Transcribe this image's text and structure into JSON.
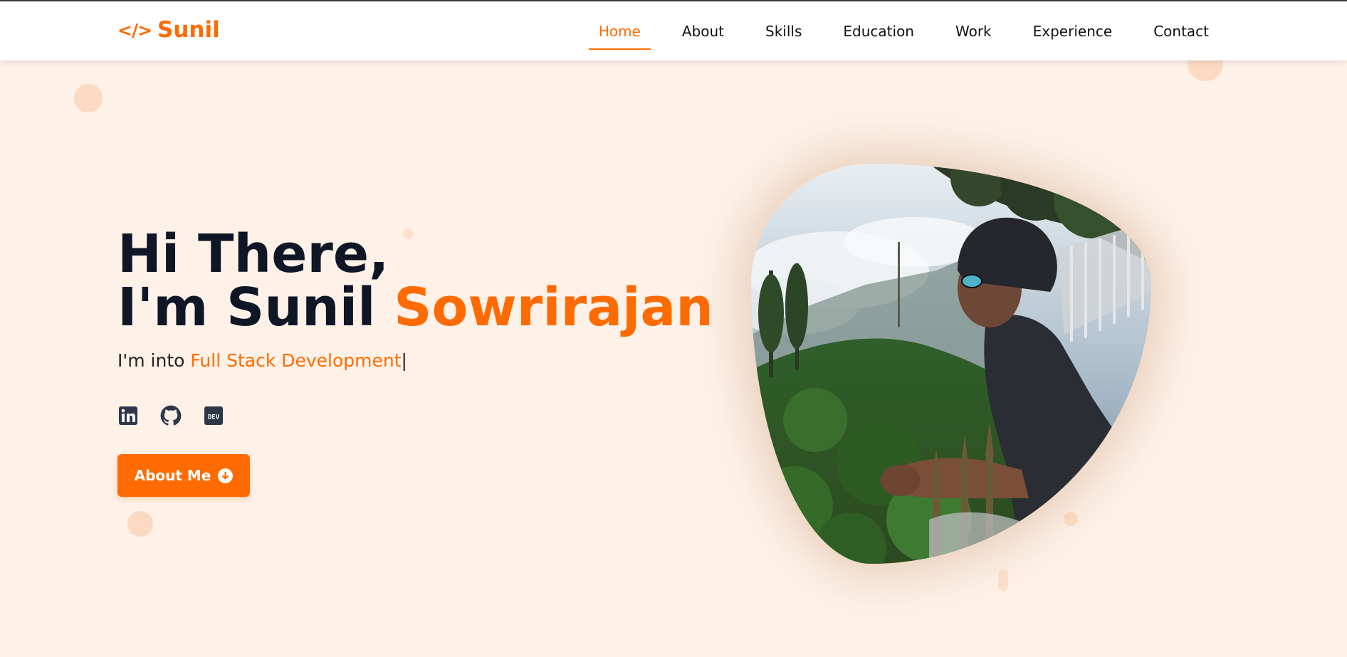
{
  "navbar": {
    "logo_icon": "</>",
    "logo_text": "Sunil",
    "links": [
      {
        "label": "Home",
        "active": true
      },
      {
        "label": "About",
        "active": false
      },
      {
        "label": "Skills",
        "active": false
      },
      {
        "label": "Education",
        "active": false
      },
      {
        "label": "Work",
        "active": false
      },
      {
        "label": "Experience",
        "active": false
      },
      {
        "label": "Contact",
        "active": false
      }
    ]
  },
  "hero": {
    "greeting": "Hi There,",
    "intro_prefix": "I'm Sunil",
    "intro_name": "Sowrirajan",
    "sub_prefix": "I'm into",
    "sub_role": "Full Stack Development",
    "sub_cursor": "|",
    "socials": [
      {
        "name": "linkedin-icon",
        "glyph": "in"
      },
      {
        "name": "github-icon",
        "glyph": ""
      },
      {
        "name": "dev-icon",
        "glyph": "DEV"
      }
    ],
    "button_label": "About Me"
  },
  "colors": {
    "accent": "#ff6b00",
    "background": "#fdf1e8",
    "heading": "#0f1626"
  }
}
